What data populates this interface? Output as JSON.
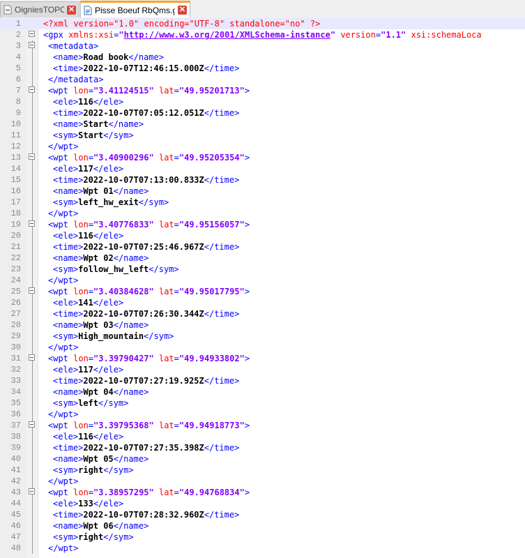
{
  "tabs": [
    {
      "label": "OigniesTOPO.imp",
      "active": false
    },
    {
      "label": "Pisse Boeuf RbQms.gpx",
      "active": true
    }
  ],
  "colors": {
    "tag": "#0000ff",
    "attr_name": "#ff0000",
    "attr_value": "#8000ff",
    "accent": "#f7a531"
  },
  "icons": {
    "tab_file": "file-icon",
    "tab_close": "close-icon",
    "fold": "fold-toggle-icon"
  },
  "lines": [
    {
      "n": "1",
      "indent": 0,
      "fold": "none",
      "parts": [
        [
          "pi",
          "<?xml version=\"1.0\" encoding=\"UTF-8\" standalone=\"no\" ?>"
        ]
      ]
    },
    {
      "n": "2",
      "indent": 0,
      "fold": "open",
      "parts": [
        [
          "tg",
          "<gpx "
        ],
        [
          "an",
          "xmlns:xsi"
        ],
        [
          "tg",
          "="
        ],
        [
          "av",
          "\""
        ],
        [
          "url",
          "http://www.w3.org/2001/XMLSchema-instance"
        ],
        [
          "av",
          "\""
        ],
        [
          "tg",
          " "
        ],
        [
          "an",
          "version"
        ],
        [
          "tg",
          "="
        ],
        [
          "av",
          "\"1.1\""
        ],
        [
          "tg",
          " "
        ],
        [
          "an",
          "xsi:schemaLoca"
        ]
      ]
    },
    {
      "n": "3",
      "indent": 1,
      "fold": "open",
      "parts": [
        [
          "tg",
          "<metadata>"
        ]
      ]
    },
    {
      "n": "4",
      "indent": 2,
      "fold": "line",
      "parts": [
        [
          "tg",
          "<name>"
        ],
        [
          "tx",
          "Road book"
        ],
        [
          "tg",
          "</name>"
        ]
      ]
    },
    {
      "n": "5",
      "indent": 2,
      "fold": "line",
      "parts": [
        [
          "tg",
          "<time>"
        ],
        [
          "tx",
          "2022-10-07T12:46:15.000Z"
        ],
        [
          "tg",
          "</time>"
        ]
      ]
    },
    {
      "n": "6",
      "indent": 1,
      "fold": "end",
      "parts": [
        [
          "tg",
          "</metadata>"
        ]
      ]
    },
    {
      "n": "7",
      "indent": 1,
      "fold": "open",
      "parts": [
        [
          "tg",
          "<wpt "
        ],
        [
          "an",
          "lon"
        ],
        [
          "tg",
          "="
        ],
        [
          "av",
          "\"3.41124515\""
        ],
        [
          "tg",
          " "
        ],
        [
          "an",
          "lat"
        ],
        [
          "tg",
          "="
        ],
        [
          "av",
          "\"49.95201713\""
        ],
        [
          "tg",
          ">"
        ]
      ]
    },
    {
      "n": "8",
      "indent": 2,
      "fold": "line",
      "parts": [
        [
          "tg",
          "<ele>"
        ],
        [
          "tx",
          "116"
        ],
        [
          "tg",
          "</ele>"
        ]
      ]
    },
    {
      "n": "9",
      "indent": 2,
      "fold": "line",
      "parts": [
        [
          "tg",
          "<time>"
        ],
        [
          "tx",
          "2022-10-07T07:05:12.051Z"
        ],
        [
          "tg",
          "</time>"
        ]
      ]
    },
    {
      "n": "10",
      "indent": 2,
      "fold": "line",
      "parts": [
        [
          "tg",
          "<name>"
        ],
        [
          "tx",
          "Start"
        ],
        [
          "tg",
          "</name>"
        ]
      ]
    },
    {
      "n": "11",
      "indent": 2,
      "fold": "line",
      "parts": [
        [
          "tg",
          "<sym>"
        ],
        [
          "tx",
          "Start"
        ],
        [
          "tg",
          "</sym>"
        ]
      ]
    },
    {
      "n": "12",
      "indent": 1,
      "fold": "end",
      "parts": [
        [
          "tg",
          "</wpt>"
        ]
      ]
    },
    {
      "n": "13",
      "indent": 1,
      "fold": "open",
      "parts": [
        [
          "tg",
          "<wpt "
        ],
        [
          "an",
          "lon"
        ],
        [
          "tg",
          "="
        ],
        [
          "av",
          "\"3.40900296\""
        ],
        [
          "tg",
          " "
        ],
        [
          "an",
          "lat"
        ],
        [
          "tg",
          "="
        ],
        [
          "av",
          "\"49.95205354\""
        ],
        [
          "tg",
          ">"
        ]
      ]
    },
    {
      "n": "14",
      "indent": 2,
      "fold": "line",
      "parts": [
        [
          "tg",
          "<ele>"
        ],
        [
          "tx",
          "117"
        ],
        [
          "tg",
          "</ele>"
        ]
      ]
    },
    {
      "n": "15",
      "indent": 2,
      "fold": "line",
      "parts": [
        [
          "tg",
          "<time>"
        ],
        [
          "tx",
          "2022-10-07T07:13:00.833Z"
        ],
        [
          "tg",
          "</time>"
        ]
      ]
    },
    {
      "n": "16",
      "indent": 2,
      "fold": "line",
      "parts": [
        [
          "tg",
          "<name>"
        ],
        [
          "tx",
          "Wpt 01"
        ],
        [
          "tg",
          "</name>"
        ]
      ]
    },
    {
      "n": "17",
      "indent": 2,
      "fold": "line",
      "parts": [
        [
          "tg",
          "<sym>"
        ],
        [
          "tx",
          "left_hw_exit"
        ],
        [
          "tg",
          "</sym>"
        ]
      ]
    },
    {
      "n": "18",
      "indent": 1,
      "fold": "end",
      "parts": [
        [
          "tg",
          "</wpt>"
        ]
      ]
    },
    {
      "n": "19",
      "indent": 1,
      "fold": "open",
      "parts": [
        [
          "tg",
          "<wpt "
        ],
        [
          "an",
          "lon"
        ],
        [
          "tg",
          "="
        ],
        [
          "av",
          "\"3.40776833\""
        ],
        [
          "tg",
          " "
        ],
        [
          "an",
          "lat"
        ],
        [
          "tg",
          "="
        ],
        [
          "av",
          "\"49.95156057\""
        ],
        [
          "tg",
          ">"
        ]
      ]
    },
    {
      "n": "20",
      "indent": 2,
      "fold": "line",
      "parts": [
        [
          "tg",
          "<ele>"
        ],
        [
          "tx",
          "116"
        ],
        [
          "tg",
          "</ele>"
        ]
      ]
    },
    {
      "n": "21",
      "indent": 2,
      "fold": "line",
      "parts": [
        [
          "tg",
          "<time>"
        ],
        [
          "tx",
          "2022-10-07T07:25:46.967Z"
        ],
        [
          "tg",
          "</time>"
        ]
      ]
    },
    {
      "n": "22",
      "indent": 2,
      "fold": "line",
      "parts": [
        [
          "tg",
          "<name>"
        ],
        [
          "tx",
          "Wpt 02"
        ],
        [
          "tg",
          "</name>"
        ]
      ]
    },
    {
      "n": "23",
      "indent": 2,
      "fold": "line",
      "parts": [
        [
          "tg",
          "<sym>"
        ],
        [
          "tx",
          "follow_hw_left"
        ],
        [
          "tg",
          "</sym>"
        ]
      ]
    },
    {
      "n": "24",
      "indent": 1,
      "fold": "end",
      "parts": [
        [
          "tg",
          "</wpt>"
        ]
      ]
    },
    {
      "n": "25",
      "indent": 1,
      "fold": "open",
      "parts": [
        [
          "tg",
          "<wpt "
        ],
        [
          "an",
          "lon"
        ],
        [
          "tg",
          "="
        ],
        [
          "av",
          "\"3.40384628\""
        ],
        [
          "tg",
          " "
        ],
        [
          "an",
          "lat"
        ],
        [
          "tg",
          "="
        ],
        [
          "av",
          "\"49.95017795\""
        ],
        [
          "tg",
          ">"
        ]
      ]
    },
    {
      "n": "26",
      "indent": 2,
      "fold": "line",
      "parts": [
        [
          "tg",
          "<ele>"
        ],
        [
          "tx",
          "141"
        ],
        [
          "tg",
          "</ele>"
        ]
      ]
    },
    {
      "n": "27",
      "indent": 2,
      "fold": "line",
      "parts": [
        [
          "tg",
          "<time>"
        ],
        [
          "tx",
          "2022-10-07T07:26:30.344Z"
        ],
        [
          "tg",
          "</time>"
        ]
      ]
    },
    {
      "n": "28",
      "indent": 2,
      "fold": "line",
      "parts": [
        [
          "tg",
          "<name>"
        ],
        [
          "tx",
          "Wpt 03"
        ],
        [
          "tg",
          "</name>"
        ]
      ]
    },
    {
      "n": "29",
      "indent": 2,
      "fold": "line",
      "parts": [
        [
          "tg",
          "<sym>"
        ],
        [
          "tx",
          "High_mountain"
        ],
        [
          "tg",
          "</sym>"
        ]
      ]
    },
    {
      "n": "30",
      "indent": 1,
      "fold": "end",
      "parts": [
        [
          "tg",
          "</wpt>"
        ]
      ]
    },
    {
      "n": "31",
      "indent": 1,
      "fold": "open",
      "parts": [
        [
          "tg",
          "<wpt "
        ],
        [
          "an",
          "lon"
        ],
        [
          "tg",
          "="
        ],
        [
          "av",
          "\"3.39790427\""
        ],
        [
          "tg",
          " "
        ],
        [
          "an",
          "lat"
        ],
        [
          "tg",
          "="
        ],
        [
          "av",
          "\"49.94933802\""
        ],
        [
          "tg",
          ">"
        ]
      ]
    },
    {
      "n": "32",
      "indent": 2,
      "fold": "line",
      "parts": [
        [
          "tg",
          "<ele>"
        ],
        [
          "tx",
          "117"
        ],
        [
          "tg",
          "</ele>"
        ]
      ]
    },
    {
      "n": "33",
      "indent": 2,
      "fold": "line",
      "parts": [
        [
          "tg",
          "<time>"
        ],
        [
          "tx",
          "2022-10-07T07:27:19.925Z"
        ],
        [
          "tg",
          "</time>"
        ]
      ]
    },
    {
      "n": "34",
      "indent": 2,
      "fold": "line",
      "parts": [
        [
          "tg",
          "<name>"
        ],
        [
          "tx",
          "Wpt 04"
        ],
        [
          "tg",
          "</name>"
        ]
      ]
    },
    {
      "n": "35",
      "indent": 2,
      "fold": "line",
      "parts": [
        [
          "tg",
          "<sym>"
        ],
        [
          "tx",
          "left"
        ],
        [
          "tg",
          "</sym>"
        ]
      ]
    },
    {
      "n": "36",
      "indent": 1,
      "fold": "end",
      "parts": [
        [
          "tg",
          "</wpt>"
        ]
      ]
    },
    {
      "n": "37",
      "indent": 1,
      "fold": "open",
      "parts": [
        [
          "tg",
          "<wpt "
        ],
        [
          "an",
          "lon"
        ],
        [
          "tg",
          "="
        ],
        [
          "av",
          "\"3.39795368\""
        ],
        [
          "tg",
          " "
        ],
        [
          "an",
          "lat"
        ],
        [
          "tg",
          "="
        ],
        [
          "av",
          "\"49.94918773\""
        ],
        [
          "tg",
          ">"
        ]
      ]
    },
    {
      "n": "38",
      "indent": 2,
      "fold": "line",
      "parts": [
        [
          "tg",
          "<ele>"
        ],
        [
          "tx",
          "116"
        ],
        [
          "tg",
          "</ele>"
        ]
      ]
    },
    {
      "n": "39",
      "indent": 2,
      "fold": "line",
      "parts": [
        [
          "tg",
          "<time>"
        ],
        [
          "tx",
          "2022-10-07T07:27:35.398Z"
        ],
        [
          "tg",
          "</time>"
        ]
      ]
    },
    {
      "n": "40",
      "indent": 2,
      "fold": "line",
      "parts": [
        [
          "tg",
          "<name>"
        ],
        [
          "tx",
          "Wpt 05"
        ],
        [
          "tg",
          "</name>"
        ]
      ]
    },
    {
      "n": "41",
      "indent": 2,
      "fold": "line",
      "parts": [
        [
          "tg",
          "<sym>"
        ],
        [
          "tx",
          "right"
        ],
        [
          "tg",
          "</sym>"
        ]
      ]
    },
    {
      "n": "42",
      "indent": 1,
      "fold": "end",
      "parts": [
        [
          "tg",
          "</wpt>"
        ]
      ]
    },
    {
      "n": "43",
      "indent": 1,
      "fold": "open",
      "parts": [
        [
          "tg",
          "<wpt "
        ],
        [
          "an",
          "lon"
        ],
        [
          "tg",
          "="
        ],
        [
          "av",
          "\"3.38957295\""
        ],
        [
          "tg",
          " "
        ],
        [
          "an",
          "lat"
        ],
        [
          "tg",
          "="
        ],
        [
          "av",
          "\"49.94768834\""
        ],
        [
          "tg",
          ">"
        ]
      ]
    },
    {
      "n": "44",
      "indent": 2,
      "fold": "line",
      "parts": [
        [
          "tg",
          "<ele>"
        ],
        [
          "tx",
          "133"
        ],
        [
          "tg",
          "</ele>"
        ]
      ]
    },
    {
      "n": "45",
      "indent": 2,
      "fold": "line",
      "parts": [
        [
          "tg",
          "<time>"
        ],
        [
          "tx",
          "2022-10-07T07:28:32.960Z"
        ],
        [
          "tg",
          "</time>"
        ]
      ]
    },
    {
      "n": "46",
      "indent": 2,
      "fold": "line",
      "parts": [
        [
          "tg",
          "<name>"
        ],
        [
          "tx",
          "Wpt 06"
        ],
        [
          "tg",
          "</name>"
        ]
      ]
    },
    {
      "n": "47",
      "indent": 2,
      "fold": "line",
      "parts": [
        [
          "tg",
          "<sym>"
        ],
        [
          "tx",
          "right"
        ],
        [
          "tg",
          "</sym>"
        ]
      ]
    },
    {
      "n": "48",
      "indent": 1,
      "fold": "end",
      "parts": [
        [
          "tg",
          "</wpt>"
        ]
      ]
    }
  ]
}
